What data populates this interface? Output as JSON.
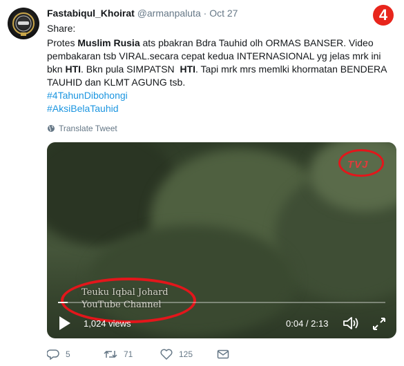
{
  "tweet": {
    "display_name": "Fastabiqul_Khoirat",
    "handle": "@armanpaluta",
    "separator": "·",
    "date": "Oct 27",
    "intro": "Share:",
    "body": {
      "l1_a": "Protes ",
      "l1_b": "Muslim Rusia",
      "l1_c": " ats pbakran Bdra Tauhid olh ORMAS BANSER. Video",
      "l2": "pembakaran tsb VIRAL.secara cepat kedua INTERNASIONAL yg jelas mrk ini",
      "l3_a": "bkn ",
      "l3_b": "HTI",
      "l3_c": ". Bkn pula SIMPATSN  ",
      "l3_d": "HTI",
      "l3_e": ". Tapi mrk mrs memlki khormatan BENDERA",
      "l4": "TAUHID dan KLMT AGUNG tsb."
    },
    "hashtags": [
      "#4TahunDibohongi",
      "#AksiBelaTauhid"
    ],
    "translate_label": "Translate Tweet"
  },
  "annotation_badge": "4",
  "video": {
    "channel_logo": "TVJ",
    "watermark_line1": "Teuku Iqbal Johard",
    "watermark_line2": "YouTube Channel",
    "views": "1,024 views",
    "time": "0:04 / 2:13",
    "progress_fraction": 0.03
  },
  "actions": {
    "replies": "5",
    "retweets": "71",
    "likes": "125"
  },
  "icons": [
    "globe-icon",
    "play-icon",
    "volume-icon",
    "fullscreen-icon",
    "reply-icon",
    "retweet-icon",
    "like-icon",
    "message-icon"
  ],
  "colors": {
    "link": "#1b95e0",
    "muted": "#657786",
    "annotation_red": "#e3161b"
  }
}
